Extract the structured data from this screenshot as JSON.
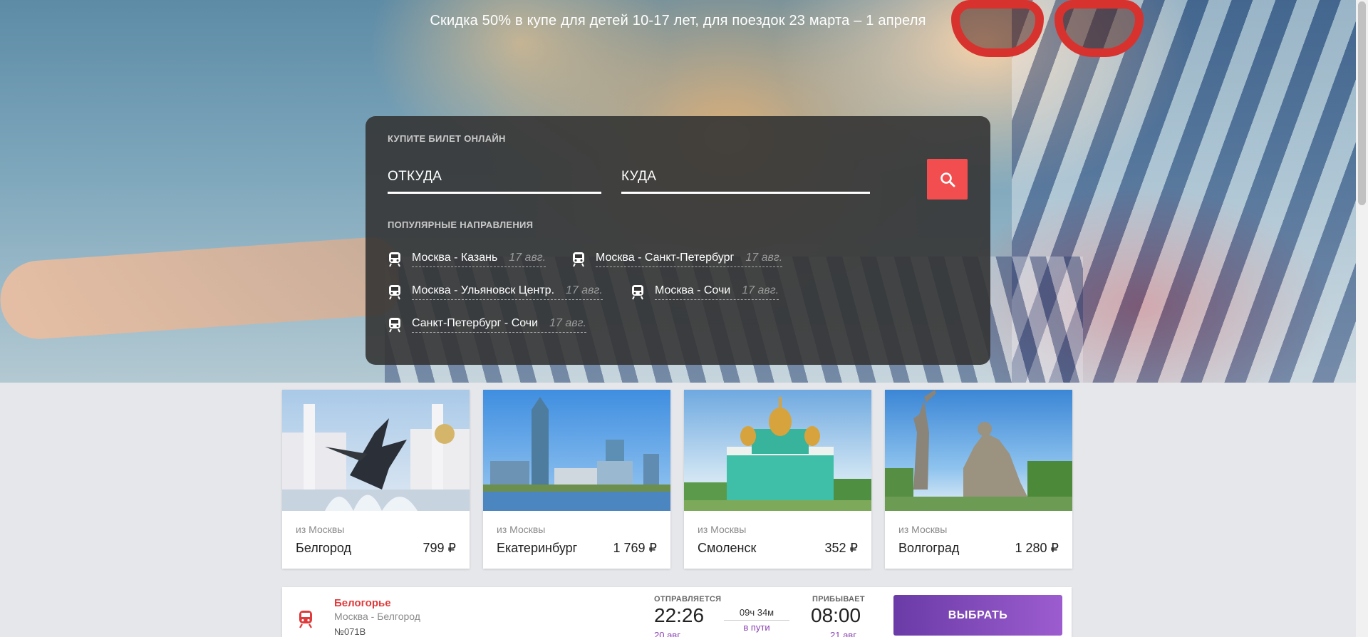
{
  "hero": {
    "promo_text": "Скидка 50% в купе для детей 10-17 лет, для поездок 23 марта – 1 апреля"
  },
  "search": {
    "title": "КУПИТЕ БИЛЕТ ОНЛАЙН",
    "from_label": "ОТКУДА",
    "to_label": "КУДА",
    "popular_title": "ПОПУЛЯРНЫЕ НАПРАВЛЕНИЯ",
    "popular": [
      {
        "name": "Москва - Казань",
        "date": "17 авг."
      },
      {
        "name": "Москва - Санкт-Петербург",
        "date": "17 авг."
      },
      {
        "name": "Москва - Ульяновск Центр.",
        "date": "17 авг."
      },
      {
        "name": "Москва - Сочи",
        "date": "17 авг."
      },
      {
        "name": "Санкт-Петербург - Сочи",
        "date": "17 авг."
      }
    ]
  },
  "cards": [
    {
      "from": "из Москвы",
      "city": "Белгород",
      "price": "799 ₽"
    },
    {
      "from": "из Москвы",
      "city": "Екатеринбург",
      "price": "1 769 ₽"
    },
    {
      "from": "из Москвы",
      "city": "Смоленск",
      "price": "352 ₽"
    },
    {
      "from": "из Москвы",
      "city": "Волгоград",
      "price": "1 280 ₽"
    }
  ],
  "train": {
    "name": "Белогорье",
    "route": "Москва - Белгород",
    "number": "№071В",
    "departs_label": "ОТПРАВЛЯЕТСЯ",
    "departs_time": "22:26",
    "departs_date": "20 авг.",
    "duration": "09ч 34м",
    "in_way": "в пути",
    "arrives_label": "ПРИБЫВАЕТ",
    "arrives_time": "08:00",
    "arrives_date": "21 авг.",
    "select_label": "ВЫБРАТЬ"
  },
  "colors": {
    "accent_red": "#f24d4f",
    "accent_purple": "#8a40b0",
    "panel_bg": "#343434"
  }
}
